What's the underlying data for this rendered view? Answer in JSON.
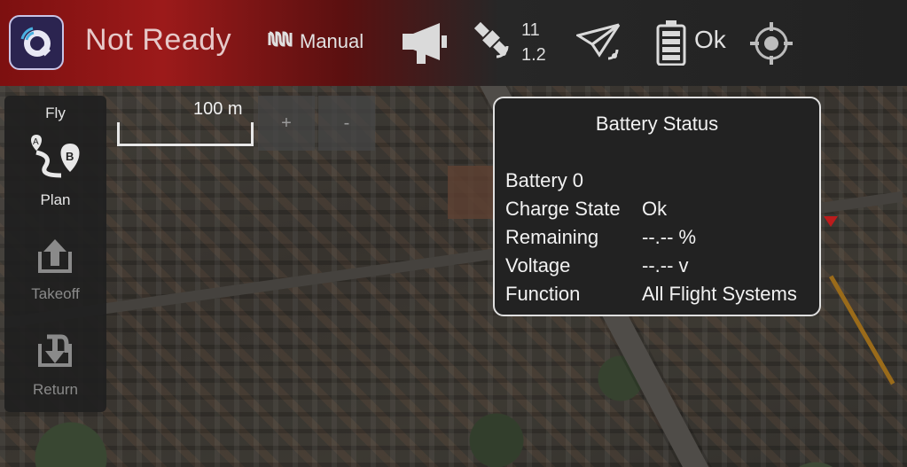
{
  "toolbar": {
    "status": "Not Ready",
    "flight_mode": "Manual",
    "satellites": {
      "count": "11",
      "hdop": "1.2"
    },
    "battery_status": "Ok"
  },
  "map": {
    "scale_label": "100 m",
    "zoom_in_label": "+",
    "zoom_out_label": "-"
  },
  "flytools": {
    "fly_label": "Fly",
    "plan_label": "Plan",
    "takeoff_label": "Takeoff",
    "return_label": "Return"
  },
  "battery_popup": {
    "title": "Battery Status",
    "battery_name": "Battery 0",
    "rows": [
      {
        "label": "Charge State",
        "value": "Ok"
      },
      {
        "label": "Remaining",
        "value": "--.-- %"
      },
      {
        "label": "Voltage",
        "value": "--.-- v"
      },
      {
        "label": "Function",
        "value": "All Flight Systems"
      }
    ]
  },
  "icons": {
    "logo": "qgc-logo-icon",
    "mode": "flight-mode-icon",
    "messages": "megaphone-icon",
    "gps": "satellite-icon",
    "rc": "paper-plane-icon",
    "battery": "battery-icon",
    "gimbal": "crosshair-icon"
  },
  "colors": {
    "toolbar_alert": "#9c1a1a",
    "toolbar_dark": "#222222",
    "popup_bg": "#222222",
    "popup_border": "#e0e0e0"
  }
}
